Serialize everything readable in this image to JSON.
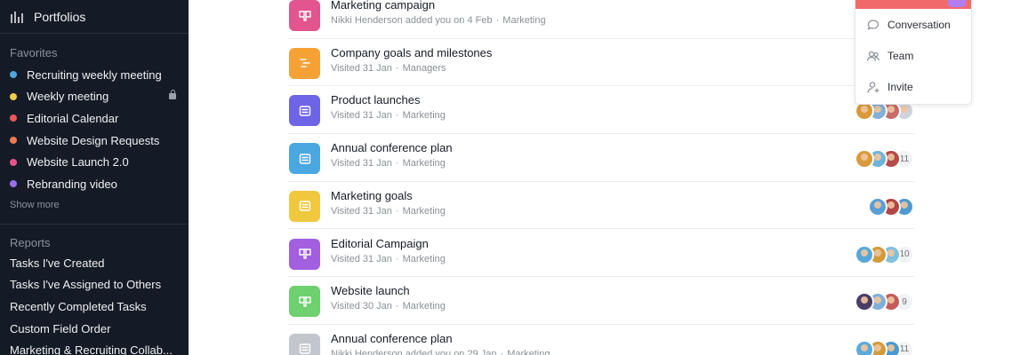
{
  "sidebar": {
    "title": "Portfolios",
    "favorites_title": "Favorites",
    "favorites": [
      {
        "label": "Recruiting weekly meeting",
        "color": "#4ea8de"
      },
      {
        "label": "Weekly meeting",
        "color": "#f2c94c",
        "locked": true
      },
      {
        "label": "Editorial Calendar",
        "color": "#eb5757"
      },
      {
        "label": "Website Design Requests",
        "color": "#f07a56"
      },
      {
        "label": "Website Launch 2.0",
        "color": "#e8548c"
      },
      {
        "label": "Rebranding video",
        "color": "#9b6cf0"
      }
    ],
    "show_more": "Show more",
    "reports_title": "Reports",
    "reports": [
      {
        "label": "Tasks I've Created"
      },
      {
        "label": "Tasks I've Assigned to Others"
      },
      {
        "label": "Recently Completed Tasks"
      },
      {
        "label": "Custom Field Order"
      },
      {
        "label": "Marketing & Recruiting Collab..."
      }
    ]
  },
  "projects": [
    {
      "name": "Marketing campaign",
      "meta": "Nikki Henderson added you on 4 Feb",
      "team": "Marketing",
      "color": "#e2558e",
      "icon": "board-icon",
      "avatars": [],
      "count": ""
    },
    {
      "name": "Company goals and milestones",
      "meta": "Visited 31 Jan",
      "team": "Managers",
      "color": "#f4a236",
      "icon": "timeline-icon",
      "avatars": [],
      "count": ""
    },
    {
      "name": "Product launches",
      "meta": "Visited 31 Jan",
      "team": "Marketing",
      "color": "#6e64e6",
      "icon": "list-icon",
      "avatars": [
        "#d99a3a",
        "#7fb0d8",
        "#c96c6c",
        "#cfd3da"
      ],
      "count": ""
    },
    {
      "name": "Annual conference plan",
      "meta": "Visited 31 Jan",
      "team": "Marketing",
      "color": "#4ba7e0",
      "icon": "list-icon",
      "avatars": [
        "#d99a3a",
        "#6fb4d9",
        "#b54a4a"
      ],
      "count": "11"
    },
    {
      "name": "Marketing goals",
      "meta": "Visited 31 Jan",
      "team": "Marketing",
      "color": "#efc83e",
      "icon": "list-icon",
      "avatars": [
        "#5a9fd4",
        "#b24545",
        "#4d9ad0"
      ],
      "count": ""
    },
    {
      "name": "Editorial Campaign",
      "meta": "Visited 31 Jan",
      "team": "Marketing",
      "color": "#a25fe0",
      "icon": "board-icon",
      "avatars": [
        "#57a8d8",
        "#d39b3c",
        "#7fc0e0"
      ],
      "count": "10"
    },
    {
      "name": "Website launch",
      "meta": "Visited 30 Jan",
      "team": "Marketing",
      "color": "#6ed06e",
      "icon": "board-icon",
      "avatars": [
        "#4b3d66",
        "#7fb0d8",
        "#c45a5a"
      ],
      "count": "9"
    },
    {
      "name": "Annual conference plan",
      "meta": "Nikki Henderson added you on 29 Jan",
      "team": "Marketing",
      "color": "#c3c6cc",
      "icon": "list-icon",
      "avatars": [
        "#5aaadb",
        "#d39b3c",
        "#4a9ad3"
      ],
      "count": "11"
    }
  ],
  "dropdown": {
    "header_color": "#f06a6a",
    "accent_color": "#b27df2",
    "items": [
      {
        "label": "Conversation",
        "icon": "chat-bubble-icon"
      },
      {
        "label": "Team",
        "icon": "team-icon"
      },
      {
        "label": "Invite",
        "icon": "add-person-icon"
      }
    ]
  }
}
